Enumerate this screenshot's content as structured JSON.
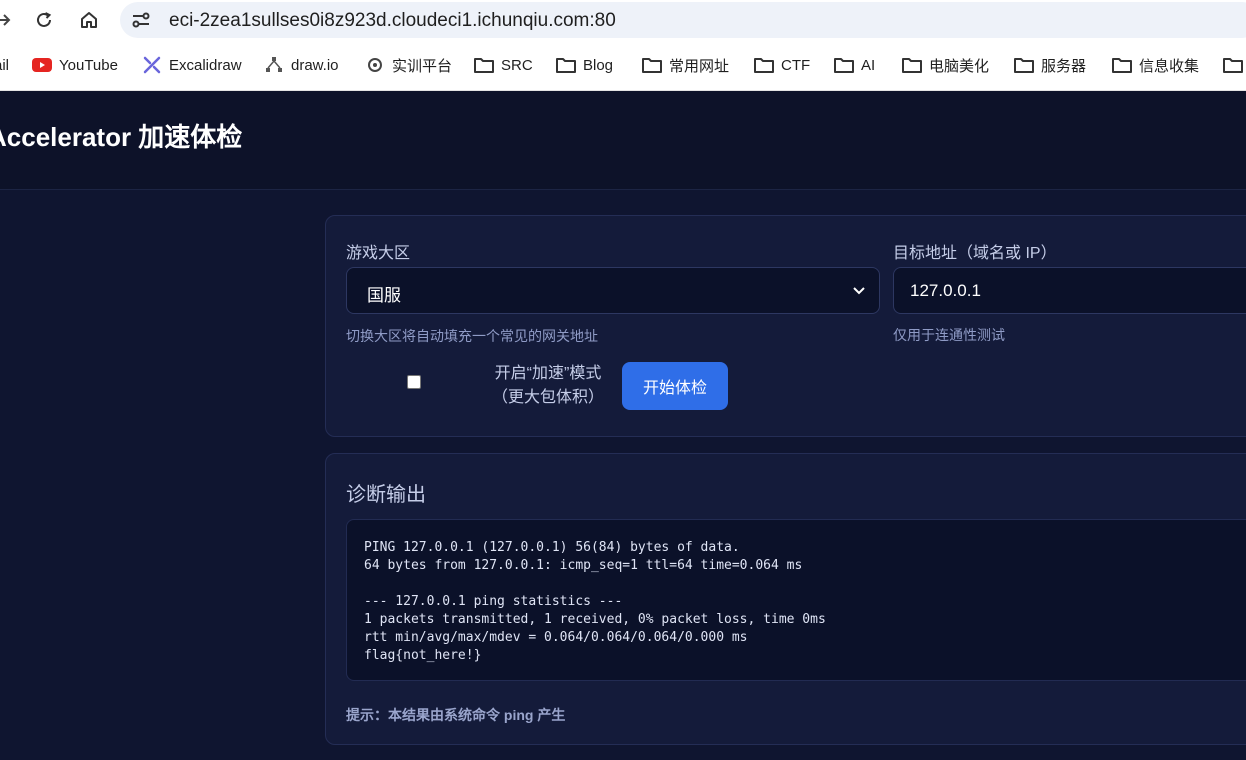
{
  "browser": {
    "url": "eci-2zea1sullses0i8z923d.cloudeci1.ichunqiu.com:80",
    "bookmarks": [
      {
        "label": "ail",
        "icon": "gmail-icon"
      },
      {
        "label": "YouTube",
        "icon": "youtube-icon"
      },
      {
        "label": "Excalidraw",
        "icon": "excalidraw-icon"
      },
      {
        "label": "draw.io",
        "icon": "drawio-icon"
      },
      {
        "label": "实训平台",
        "icon": "training-platform-icon"
      },
      {
        "label": "SRC",
        "icon": "folder-icon"
      },
      {
        "label": "Blog",
        "icon": "folder-icon"
      },
      {
        "label": "常用网址",
        "icon": "folder-icon"
      },
      {
        "label": "CTF",
        "icon": "folder-icon"
      },
      {
        "label": "AI",
        "icon": "folder-icon"
      },
      {
        "label": "电脑美化",
        "icon": "folder-icon"
      },
      {
        "label": "服务器",
        "icon": "folder-icon"
      },
      {
        "label": "信息收集",
        "icon": "folder-icon"
      },
      {
        "label": "",
        "icon": "folder-icon"
      }
    ]
  },
  "page": {
    "title": "Accelerator 加速体检"
  },
  "form": {
    "region_label": "游戏大区",
    "region_value": "国服",
    "region_hint": "切换大区将自动填充一个常见的网关地址",
    "target_label": "目标地址（域名或 IP）",
    "target_value": "127.0.0.1",
    "target_hint": "仅用于连通性测试",
    "accel_mode_line1": "开启“加速”模式",
    "accel_mode_line2": "（更大包体积）",
    "accel_mode_checked": false,
    "start_button": "开始体检"
  },
  "output": {
    "title": "诊断输出",
    "text": "PING 127.0.0.1 (127.0.0.1) 56(84) bytes of data.\n64 bytes from 127.0.0.1: icmp_seq=1 ttl=64 time=0.064 ms\n\n--- 127.0.0.1 ping statistics ---\n1 packets transmitted, 1 received, 0% packet loss, time 0ms\nrtt min/avg/max/mdev = 0.064/0.064/0.064/0.000 ms\nflag{not_here!}",
    "hint_prefix": "提示：",
    "hint_text": "本结果由系统命令 ping 产生"
  },
  "colors": {
    "background": "#0f1530",
    "card": "#141b3a",
    "accent": "#2f6ee8"
  }
}
